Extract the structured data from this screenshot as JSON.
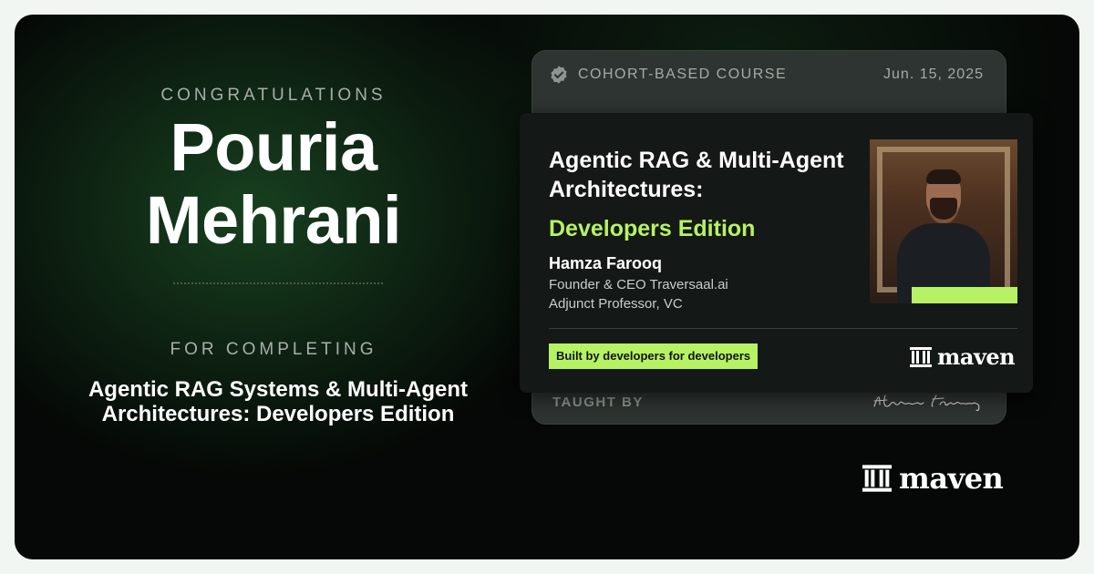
{
  "left": {
    "congrats_label": "CONGRATULATIONS",
    "name_line1": "Pouria",
    "name_line2": "Mehrani",
    "for_completing_label": "FOR COMPLETING",
    "course_title": "Agentic RAG Systems & Multi-Agent Architectures: Developers Edition"
  },
  "card": {
    "badge_label": "COHORT-BASED COURSE",
    "date": "Jun. 15, 2025",
    "title": "Agentic RAG & Multi-Agent Architectures:",
    "edition": "Developers Edition",
    "instructor_name": "Hamza Farooq",
    "instructor_role1": "Founder & CEO Traversaal.ai",
    "instructor_role2": "Adjunct Professor, VC",
    "tagline": "Built by developers for developers",
    "brand_small": "maven",
    "taught_by_label": "TAUGHT BY",
    "signature_text": "Hamza Farooq"
  },
  "brand": {
    "name": "maven"
  },
  "colors": {
    "accent": "#b6f263",
    "background": "#050806",
    "card": "#2e3431"
  },
  "icons": {
    "badge": "verified-badge-icon",
    "logo": "maven-pillars-icon"
  }
}
